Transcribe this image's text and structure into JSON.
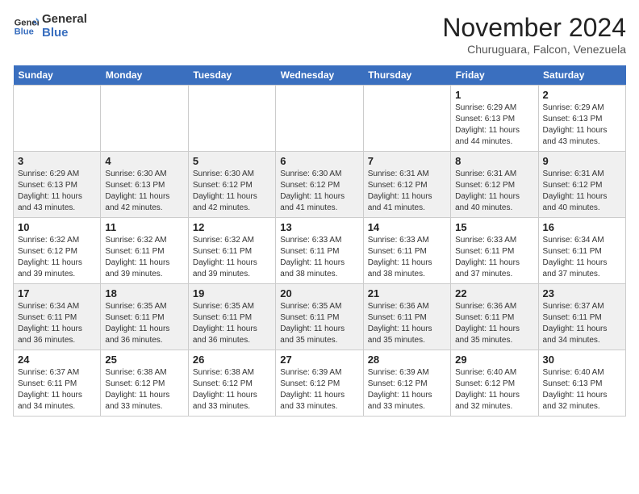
{
  "header": {
    "logo_line1": "General",
    "logo_line2": "Blue",
    "month": "November 2024",
    "location": "Churuguara, Falcon, Venezuela"
  },
  "weekdays": [
    "Sunday",
    "Monday",
    "Tuesday",
    "Wednesday",
    "Thursday",
    "Friday",
    "Saturday"
  ],
  "weeks": [
    [
      {
        "day": "",
        "info": ""
      },
      {
        "day": "",
        "info": ""
      },
      {
        "day": "",
        "info": ""
      },
      {
        "day": "",
        "info": ""
      },
      {
        "day": "",
        "info": ""
      },
      {
        "day": "1",
        "info": "Sunrise: 6:29 AM\nSunset: 6:13 PM\nDaylight: 11 hours\nand 44 minutes."
      },
      {
        "day": "2",
        "info": "Sunrise: 6:29 AM\nSunset: 6:13 PM\nDaylight: 11 hours\nand 43 minutes."
      }
    ],
    [
      {
        "day": "3",
        "info": "Sunrise: 6:29 AM\nSunset: 6:13 PM\nDaylight: 11 hours\nand 43 minutes."
      },
      {
        "day": "4",
        "info": "Sunrise: 6:30 AM\nSunset: 6:13 PM\nDaylight: 11 hours\nand 42 minutes."
      },
      {
        "day": "5",
        "info": "Sunrise: 6:30 AM\nSunset: 6:12 PM\nDaylight: 11 hours\nand 42 minutes."
      },
      {
        "day": "6",
        "info": "Sunrise: 6:30 AM\nSunset: 6:12 PM\nDaylight: 11 hours\nand 41 minutes."
      },
      {
        "day": "7",
        "info": "Sunrise: 6:31 AM\nSunset: 6:12 PM\nDaylight: 11 hours\nand 41 minutes."
      },
      {
        "day": "8",
        "info": "Sunrise: 6:31 AM\nSunset: 6:12 PM\nDaylight: 11 hours\nand 40 minutes."
      },
      {
        "day": "9",
        "info": "Sunrise: 6:31 AM\nSunset: 6:12 PM\nDaylight: 11 hours\nand 40 minutes."
      }
    ],
    [
      {
        "day": "10",
        "info": "Sunrise: 6:32 AM\nSunset: 6:12 PM\nDaylight: 11 hours\nand 39 minutes."
      },
      {
        "day": "11",
        "info": "Sunrise: 6:32 AM\nSunset: 6:11 PM\nDaylight: 11 hours\nand 39 minutes."
      },
      {
        "day": "12",
        "info": "Sunrise: 6:32 AM\nSunset: 6:11 PM\nDaylight: 11 hours\nand 39 minutes."
      },
      {
        "day": "13",
        "info": "Sunrise: 6:33 AM\nSunset: 6:11 PM\nDaylight: 11 hours\nand 38 minutes."
      },
      {
        "day": "14",
        "info": "Sunrise: 6:33 AM\nSunset: 6:11 PM\nDaylight: 11 hours\nand 38 minutes."
      },
      {
        "day": "15",
        "info": "Sunrise: 6:33 AM\nSunset: 6:11 PM\nDaylight: 11 hours\nand 37 minutes."
      },
      {
        "day": "16",
        "info": "Sunrise: 6:34 AM\nSunset: 6:11 PM\nDaylight: 11 hours\nand 37 minutes."
      }
    ],
    [
      {
        "day": "17",
        "info": "Sunrise: 6:34 AM\nSunset: 6:11 PM\nDaylight: 11 hours\nand 36 minutes."
      },
      {
        "day": "18",
        "info": "Sunrise: 6:35 AM\nSunset: 6:11 PM\nDaylight: 11 hours\nand 36 minutes."
      },
      {
        "day": "19",
        "info": "Sunrise: 6:35 AM\nSunset: 6:11 PM\nDaylight: 11 hours\nand 36 minutes."
      },
      {
        "day": "20",
        "info": "Sunrise: 6:35 AM\nSunset: 6:11 PM\nDaylight: 11 hours\nand 35 minutes."
      },
      {
        "day": "21",
        "info": "Sunrise: 6:36 AM\nSunset: 6:11 PM\nDaylight: 11 hours\nand 35 minutes."
      },
      {
        "day": "22",
        "info": "Sunrise: 6:36 AM\nSunset: 6:11 PM\nDaylight: 11 hours\nand 35 minutes."
      },
      {
        "day": "23",
        "info": "Sunrise: 6:37 AM\nSunset: 6:11 PM\nDaylight: 11 hours\nand 34 minutes."
      }
    ],
    [
      {
        "day": "24",
        "info": "Sunrise: 6:37 AM\nSunset: 6:11 PM\nDaylight: 11 hours\nand 34 minutes."
      },
      {
        "day": "25",
        "info": "Sunrise: 6:38 AM\nSunset: 6:12 PM\nDaylight: 11 hours\nand 33 minutes."
      },
      {
        "day": "26",
        "info": "Sunrise: 6:38 AM\nSunset: 6:12 PM\nDaylight: 11 hours\nand 33 minutes."
      },
      {
        "day": "27",
        "info": "Sunrise: 6:39 AM\nSunset: 6:12 PM\nDaylight: 11 hours\nand 33 minutes."
      },
      {
        "day": "28",
        "info": "Sunrise: 6:39 AM\nSunset: 6:12 PM\nDaylight: 11 hours\nand 33 minutes."
      },
      {
        "day": "29",
        "info": "Sunrise: 6:40 AM\nSunset: 6:12 PM\nDaylight: 11 hours\nand 32 minutes."
      },
      {
        "day": "30",
        "info": "Sunrise: 6:40 AM\nSunset: 6:13 PM\nDaylight: 11 hours\nand 32 minutes."
      }
    ]
  ]
}
